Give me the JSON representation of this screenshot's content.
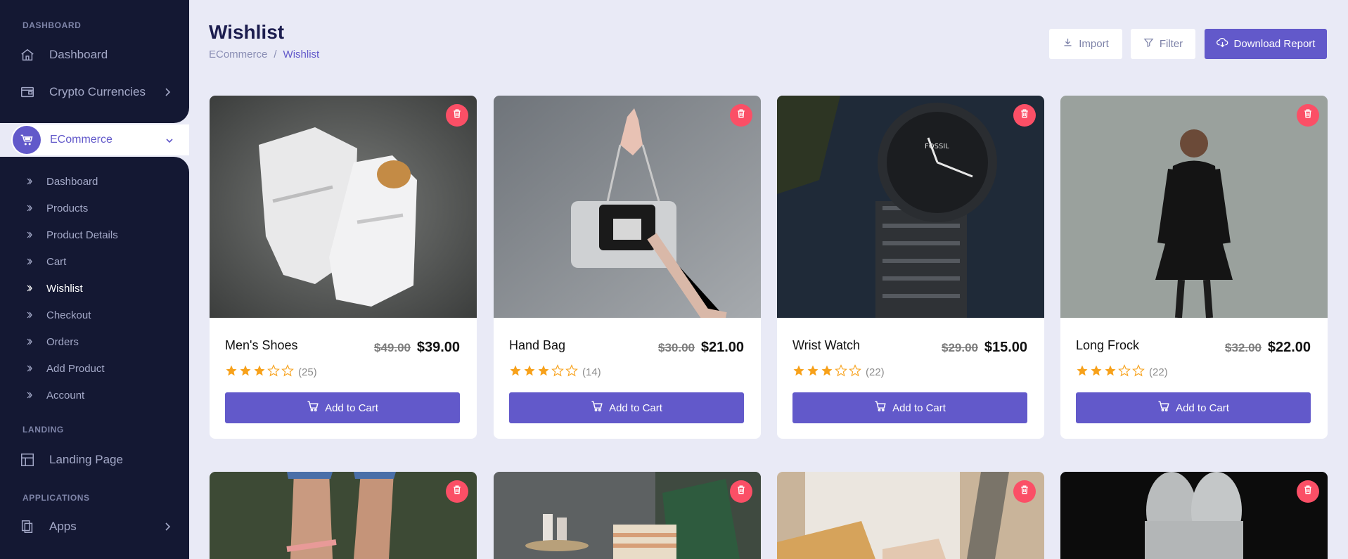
{
  "sidebar": {
    "sections": {
      "dashboard": "DASHBOARD",
      "landing": "LANDING",
      "applications": "APPLICATIONS"
    },
    "main_items": {
      "dashboard": "Dashboard",
      "crypto": "Crypto Currencies",
      "ecommerce": "ECommerce",
      "landing_page": "Landing Page",
      "apps": "Apps"
    },
    "sub_items": [
      "Dashboard",
      "Products",
      "Product Details",
      "Cart",
      "Wishlist",
      "Checkout",
      "Orders",
      "Add Product",
      "Account"
    ],
    "active_sub": "Wishlist"
  },
  "header": {
    "title": "Wishlist",
    "breadcrumb": [
      "ECommerce",
      "/",
      "Wishlist"
    ],
    "import_label": "Import",
    "filter_label": "Filter",
    "download_label": "Download Report"
  },
  "products": [
    {
      "name": "Men's Shoes",
      "old_price": "$49.00",
      "price": "$39.00",
      "rating": 3,
      "reviews": "(25)",
      "cart_label": "Add to Cart"
    },
    {
      "name": "Hand Bag",
      "old_price": "$30.00",
      "price": "$21.00",
      "rating": 3,
      "reviews": "(14)",
      "cart_label": "Add to Cart"
    },
    {
      "name": "Wrist Watch",
      "old_price": "$29.00",
      "price": "$15.00",
      "rating": 3,
      "reviews": "(22)",
      "cart_label": "Add to Cart"
    },
    {
      "name": "Long Frock",
      "old_price": "$32.00",
      "price": "$22.00",
      "rating": 3,
      "reviews": "(22)",
      "cart_label": "Add to Cart"
    }
  ],
  "colors": {
    "primary": "#6259ca",
    "sidebar_bg": "#141833",
    "page_bg": "#e9eaf6",
    "danger": "#fb4f66",
    "star": "#f7a11a"
  }
}
